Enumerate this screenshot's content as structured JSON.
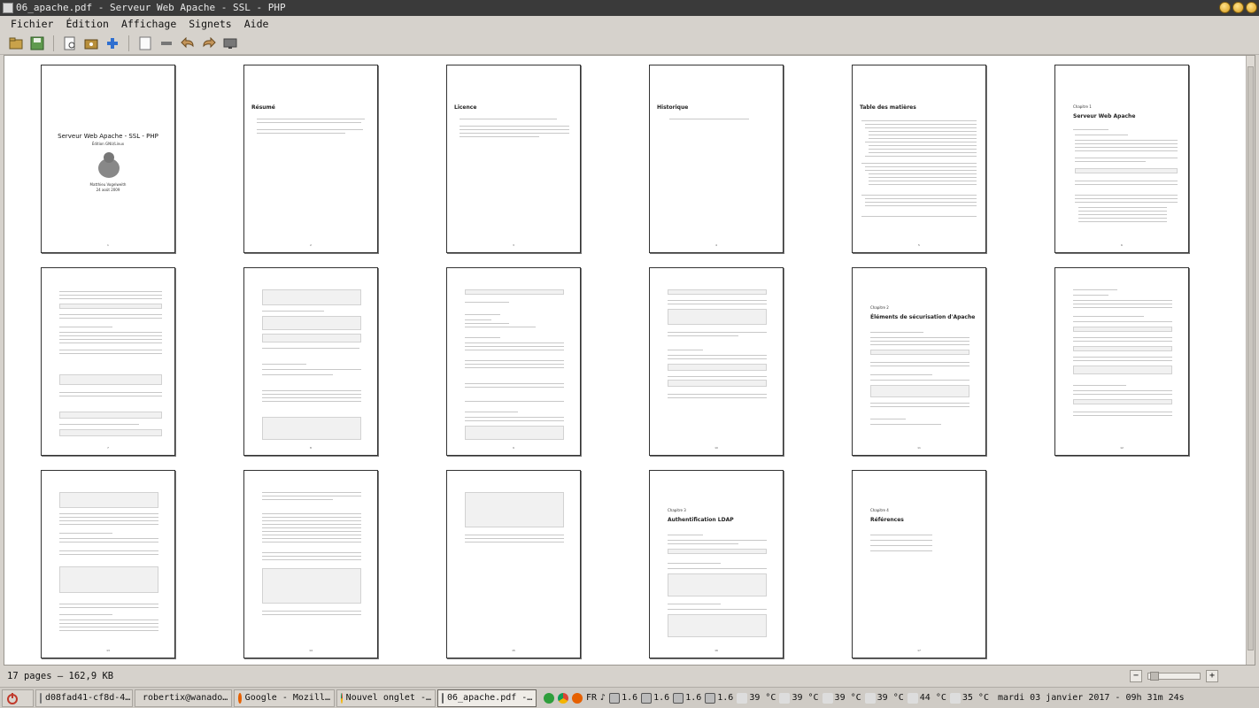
{
  "window": {
    "title": "06_apache.pdf - Serveur Web Apache - SSL - PHP"
  },
  "menu": {
    "items": [
      "Fichier",
      "Édition",
      "Affichage",
      "Signets",
      "Aide"
    ]
  },
  "toolbar": {
    "icons": [
      "open-folder-icon",
      "save-icon",
      "print-preview-icon",
      "open-icon",
      "add-icon",
      "new-page-icon",
      "minus-icon",
      "back-icon",
      "forward-icon",
      "presentation-icon"
    ]
  },
  "document": {
    "pages": [
      {
        "title": "Serveur Web Apache - SSL - PHP",
        "subtitle": "Édition GNU/Linux",
        "author": "Matthieu Vogelweith",
        "date": "24 août 2009",
        "num": "1"
      },
      {
        "title": "Résumé",
        "num": "2"
      },
      {
        "title": "Licence",
        "num": "3"
      },
      {
        "title": "Historique",
        "num": "4"
      },
      {
        "title": "Table des matières",
        "num": "5"
      },
      {
        "chapter": "Chapitre 1",
        "title": "Serveur Web Apache",
        "num": "6"
      },
      {
        "num": "7"
      },
      {
        "num": "8"
      },
      {
        "num": "9"
      },
      {
        "num": "10"
      },
      {
        "chapter": "Chapitre 2",
        "title": "Éléments de sécurisation d'Apache",
        "num": "11"
      },
      {
        "num": "12"
      },
      {
        "num": "13"
      },
      {
        "num": "14"
      },
      {
        "num": "15"
      },
      {
        "chapter": "Chapitre 3",
        "title": "Authentification LDAP",
        "num": "16"
      },
      {
        "chapter": "Chapitre 4",
        "title": "Références",
        "num": "17"
      }
    ]
  },
  "status": {
    "pages_info": "17 pages – 162,9 KB"
  },
  "taskbar": {
    "tasks": [
      "d08fad41-cf8d-4…",
      "robertix@wanado…",
      "Google - Mozill…",
      "Nouvel onglet -…",
      "06_apache.pdf -…"
    ],
    "active_index": 4,
    "keyboard_layout": "FR",
    "cpu": [
      "1.6",
      "1.6",
      "1.6",
      "1.6"
    ],
    "temps": [
      "39 °C",
      "39 °C",
      "39 °C",
      "39 °C",
      "44 °C",
      "35 °C"
    ],
    "clock": "mardi 03 janvier 2017 - 09h 31m 24s"
  }
}
